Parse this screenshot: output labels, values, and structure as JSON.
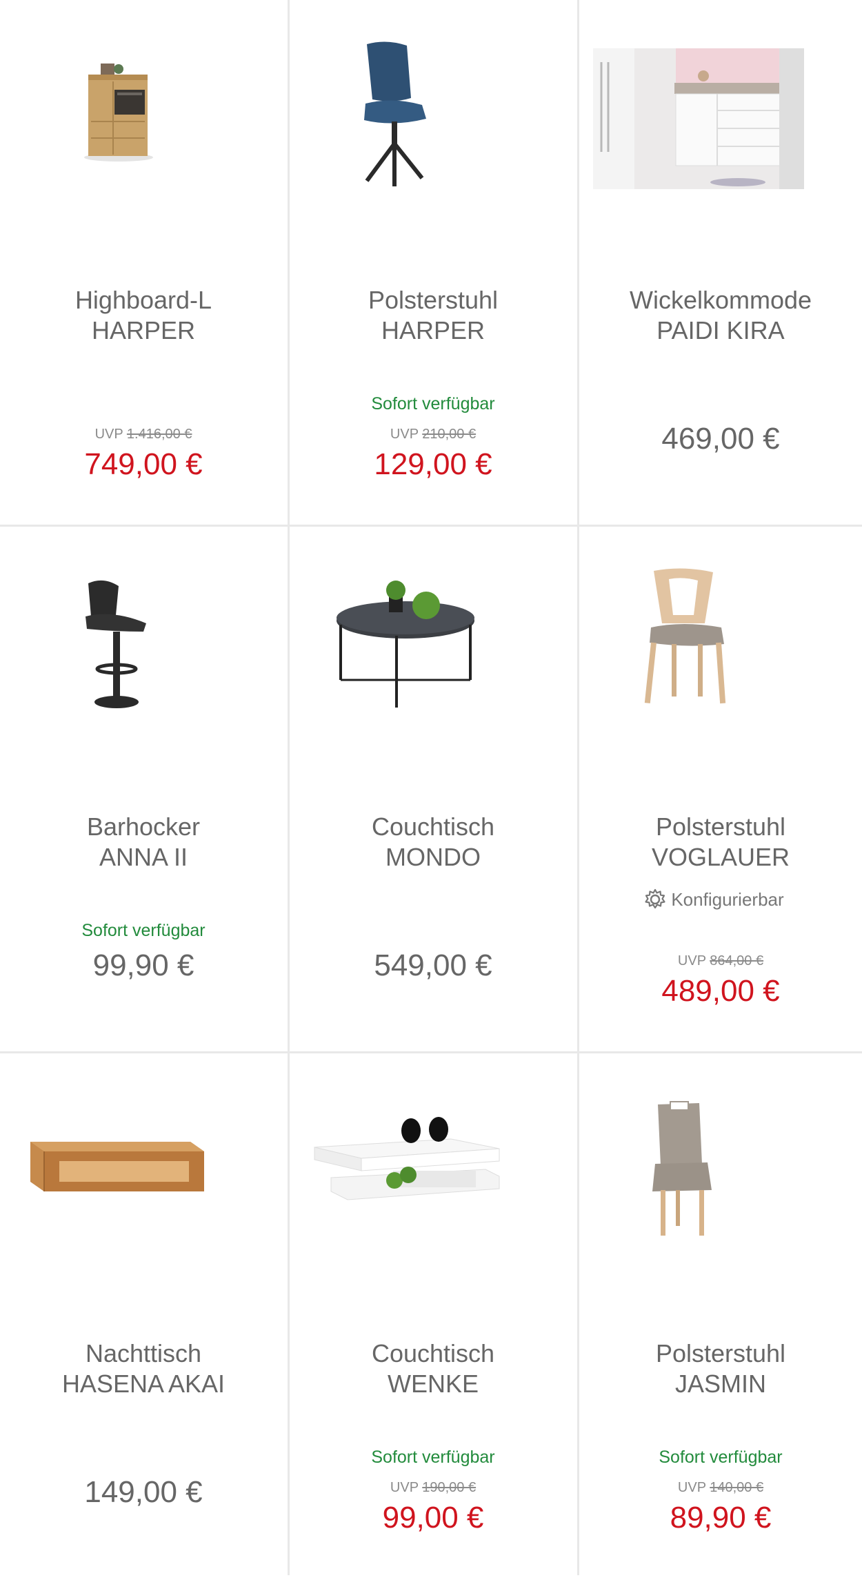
{
  "colors": {
    "sale_price": "#d0141e",
    "regular_price": "#666666",
    "availability": "#228b3c",
    "divider": "#e8e8e8"
  },
  "products": [
    {
      "name_line1": "Highboard-L",
      "name_line2": "HARPER",
      "availability": "",
      "uvp_label": "UVP",
      "uvp_price": "1.416,00 €",
      "price": "749,00 €",
      "on_sale": true,
      "configurable": "",
      "image": "highboard-image"
    },
    {
      "name_line1": "Polsterstuhl",
      "name_line2": "HARPER",
      "availability": "Sofort verfügbar",
      "uvp_label": "UVP",
      "uvp_price": "210,00 €",
      "price": "129,00 €",
      "on_sale": true,
      "configurable": "",
      "image": "blue-chair-image"
    },
    {
      "name_line1": "Wickelkommode",
      "name_line2": "PAIDI KIRA",
      "availability": "",
      "uvp_label": "",
      "uvp_price": "",
      "price": "469,00 €",
      "on_sale": false,
      "configurable": "",
      "image": "changing-dresser-image"
    },
    {
      "name_line1": "Barhocker",
      "name_line2": "ANNA II",
      "availability": "Sofort verfügbar",
      "uvp_label": "",
      "uvp_price": "",
      "price": "99,90 €",
      "on_sale": false,
      "configurable": "",
      "image": "bar-stool-image"
    },
    {
      "name_line1": "Couchtisch",
      "name_line2": "MONDO",
      "availability": "",
      "uvp_label": "",
      "uvp_price": "",
      "price": "549,00 €",
      "on_sale": false,
      "configurable": "",
      "image": "round-coffee-table-image"
    },
    {
      "name_line1": "Polsterstuhl",
      "name_line2": "VOGLAUER",
      "availability": "",
      "uvp_label": "UVP",
      "uvp_price": "864,00 €",
      "price": "489,00 €",
      "on_sale": true,
      "configurable": "Konfigurierbar",
      "image": "wooden-chair-image"
    },
    {
      "name_line1": "Nachttisch",
      "name_line2": "HASENA AKAI",
      "availability": "",
      "uvp_label": "",
      "uvp_price": "",
      "price": "149,00 €",
      "on_sale": false,
      "configurable": "",
      "image": "nightstand-image"
    },
    {
      "name_line1": "Couchtisch",
      "name_line2": "WENKE",
      "availability": "Sofort verfügbar",
      "uvp_label": "UVP",
      "uvp_price": "190,00 €",
      "price": "99,00 €",
      "on_sale": true,
      "configurable": "",
      "image": "white-coffee-table-image"
    },
    {
      "name_line1": "Polsterstuhl",
      "name_line2": "JASMIN",
      "availability": "Sofort verfügbar",
      "uvp_label": "UVP",
      "uvp_price": "140,00 €",
      "price": "89,90 €",
      "on_sale": true,
      "configurable": "",
      "image": "grey-chair-image"
    }
  ]
}
